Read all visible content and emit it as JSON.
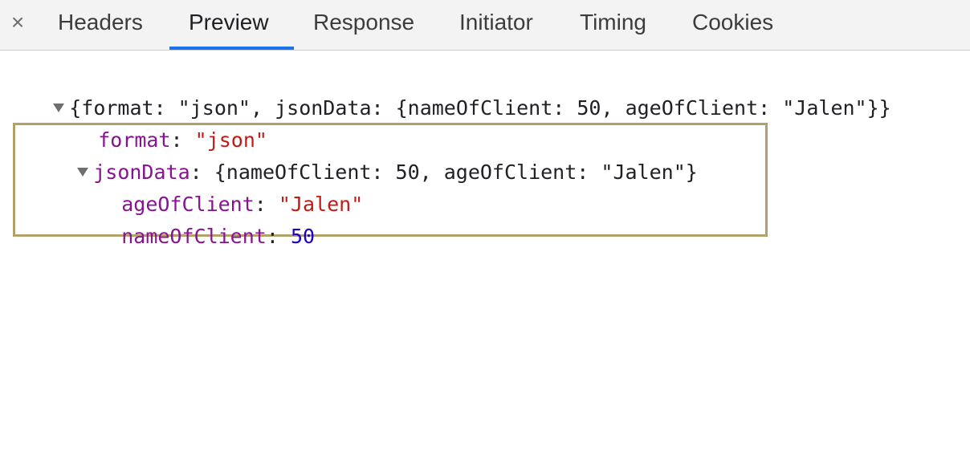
{
  "tabs": {
    "close_glyph": "×",
    "items": [
      {
        "label": "Headers"
      },
      {
        "label": "Preview"
      },
      {
        "label": "Response"
      },
      {
        "label": "Initiator"
      },
      {
        "label": "Timing"
      },
      {
        "label": "Cookies"
      }
    ],
    "active": "Preview",
    "accent_color": "#1a73e8"
  },
  "preview": {
    "root_summary": "{format: \"json\", jsonData: {nameOfClient: 50, ageOfClient: \"Jalen\"}}",
    "format": {
      "key": "format",
      "sep": ": ",
      "value": "\"json\""
    },
    "jsonData": {
      "key": "jsonData",
      "sep": ": ",
      "summary": "{nameOfClient: 50, ageOfClient: \"Jalen\"}",
      "children": [
        {
          "key": "ageOfClient",
          "sep": ": ",
          "value": "\"Jalen\"",
          "type": "string"
        },
        {
          "key": "nameOfClient",
          "sep": ": ",
          "value": "50",
          "type": "number"
        }
      ]
    },
    "colors": {
      "key": "#881391",
      "string": "#c41a16",
      "number": "#1c00cf",
      "highlight_border": "#b2a26a"
    }
  }
}
